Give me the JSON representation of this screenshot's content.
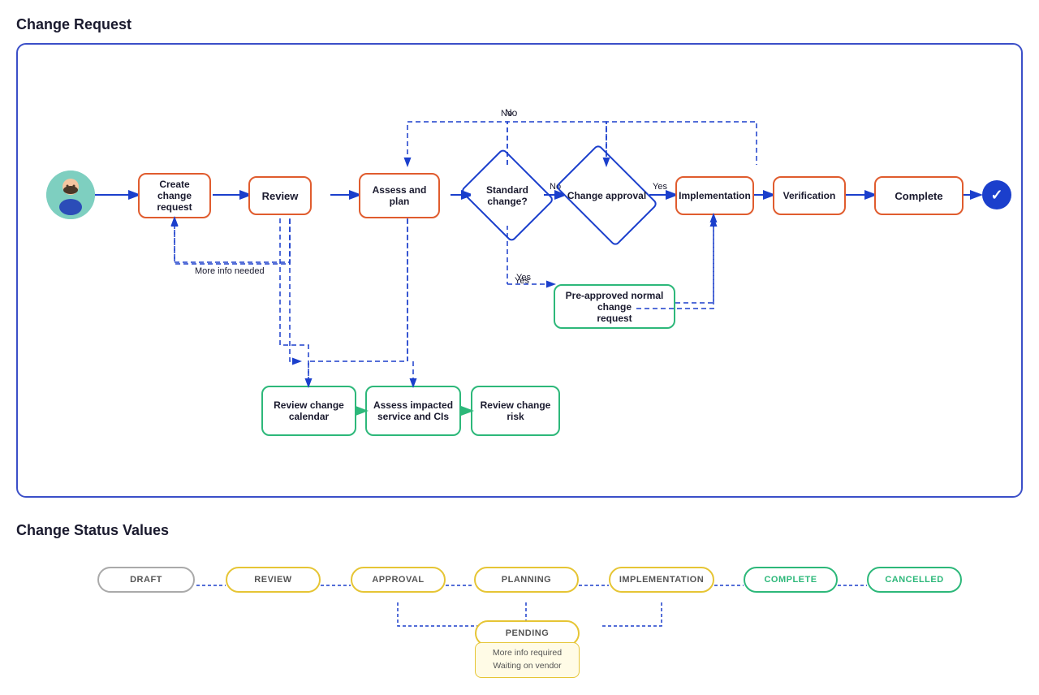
{
  "diagram": {
    "title": "Change Request",
    "nodes": {
      "avatar": {
        "label": "Person"
      },
      "create": {
        "label": "Create\nchange\nrequest"
      },
      "review": {
        "label": "Review"
      },
      "assess": {
        "label": "Assess and\nplan"
      },
      "standard": {
        "label": "Standard\nchange?"
      },
      "approval": {
        "label": "Change\napproval"
      },
      "implementation": {
        "label": "Implementation"
      },
      "verification": {
        "label": "Verification"
      },
      "complete": {
        "label": "Complete"
      },
      "preapproved": {
        "label": "Pre-approved normal change\nrequest"
      },
      "calendar": {
        "label": "Review change\ncalendar"
      },
      "impacted": {
        "label": "Assess impacted\nservice and CIs"
      },
      "risk": {
        "label": "Review change\nrisk"
      },
      "moreInfo": {
        "label": "More info needed"
      }
    },
    "labels": {
      "no1": "No",
      "no2": "No",
      "yes1": "Yes",
      "yes2": "Yes"
    }
  },
  "status": {
    "title": "Change Status Values",
    "nodes": [
      {
        "id": "draft",
        "label": "DRAFT",
        "type": "gray"
      },
      {
        "id": "review",
        "label": "REVIEW",
        "type": "yellow"
      },
      {
        "id": "approval",
        "label": "APPROVAL",
        "type": "yellow"
      },
      {
        "id": "planning",
        "label": "PLANNING",
        "type": "yellow"
      },
      {
        "id": "implementation",
        "label": "IMPLEMENTATION",
        "type": "yellow"
      },
      {
        "id": "complete",
        "label": "COMPLETE",
        "type": "green"
      },
      {
        "id": "cancelled",
        "label": "CANCELLED",
        "type": "green"
      }
    ],
    "pending": {
      "label": "PENDING",
      "subtext": "More info required\nWaiting on vendor"
    }
  }
}
